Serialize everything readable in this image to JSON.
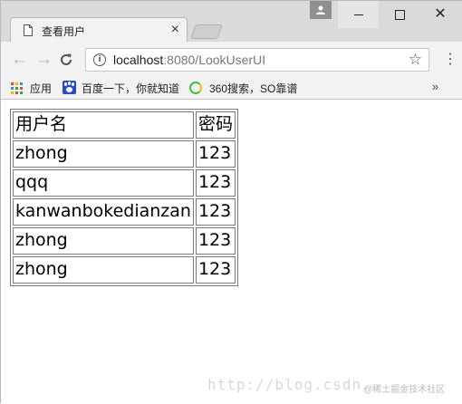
{
  "tab": {
    "title": "查看用户",
    "close": "×"
  },
  "window": {
    "minimize": "",
    "maximize": "",
    "close": "✕"
  },
  "toolbar": {
    "back": "←",
    "forward": "→",
    "reload": "C",
    "url_host": "localhost",
    "url_path": ":8080/LookUserUI",
    "info": "i",
    "star": "☆",
    "menu": "⋮"
  },
  "bookmarks": {
    "items": [
      {
        "label": "应用",
        "icon": "apps-icon"
      },
      {
        "label": "百度一下，你就知道",
        "icon": "baidu-icon"
      },
      {
        "label": "360搜索，SO靠谱",
        "icon": "360-icon"
      }
    ],
    "more": "»"
  },
  "table": {
    "headers": [
      "用户名",
      "密码"
    ],
    "rows": [
      [
        "zhong",
        "123"
      ],
      [
        "qqq",
        "123"
      ],
      [
        "kanwanbokedianzan",
        "123"
      ],
      [
        "zhong",
        "123"
      ],
      [
        "zhong",
        "123"
      ]
    ]
  },
  "watermark": "http://blog.csdn.",
  "credit": "@稀土掘金技术社区",
  "colors": {
    "chrome_bg": "#f2f2f2",
    "titlebar_bg": "#dadada",
    "table_border": "#7a7a7a"
  }
}
